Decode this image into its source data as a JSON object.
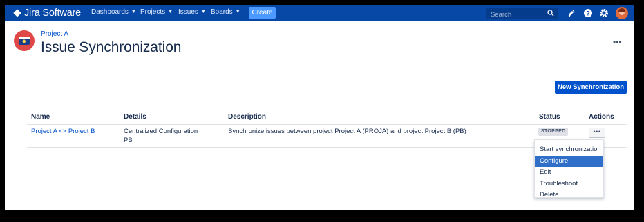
{
  "nav": {
    "product_name": "Jira Software",
    "menus": [
      {
        "label": "Dashboards"
      },
      {
        "label": "Projects"
      },
      {
        "label": "Issues"
      },
      {
        "label": "Boards"
      }
    ],
    "create_label": "Create",
    "search_placeholder": "Search",
    "icons": [
      "search-icon",
      "notifications-icon",
      "help-icon",
      "settings-icon",
      "user-avatar"
    ]
  },
  "header": {
    "breadcrumb": "Project A",
    "title": "Issue Synchronization",
    "more_label": "•••"
  },
  "toolbar": {
    "new_sync_label": "New Synchronization"
  },
  "table": {
    "columns": [
      "Name",
      "Details",
      "Description",
      "Status",
      "Actions"
    ],
    "rows": [
      {
        "name": "Project A <> Project B",
        "details_line1": "Centralized Configuration",
        "details_line2": "PB",
        "description": "Synchronize issues between project Project A (PROJA) and project Project B (PB)",
        "status": "STOPPED",
        "actions_label": "•••"
      }
    ]
  },
  "actions_menu": {
    "items": [
      {
        "label": "Start synchronization",
        "active": false
      },
      {
        "label": "Configure",
        "active": true
      },
      {
        "label": "Edit",
        "active": false
      },
      {
        "label": "Troubleshoot",
        "active": false
      },
      {
        "label": "Delete",
        "active": false
      }
    ]
  },
  "colors": {
    "nav_bg": "#0747a6",
    "primary": "#0052cc",
    "create_btn": "#4c9aff",
    "menu_active": "#2f6ec9",
    "status_badge_bg": "#dfe1e6"
  }
}
